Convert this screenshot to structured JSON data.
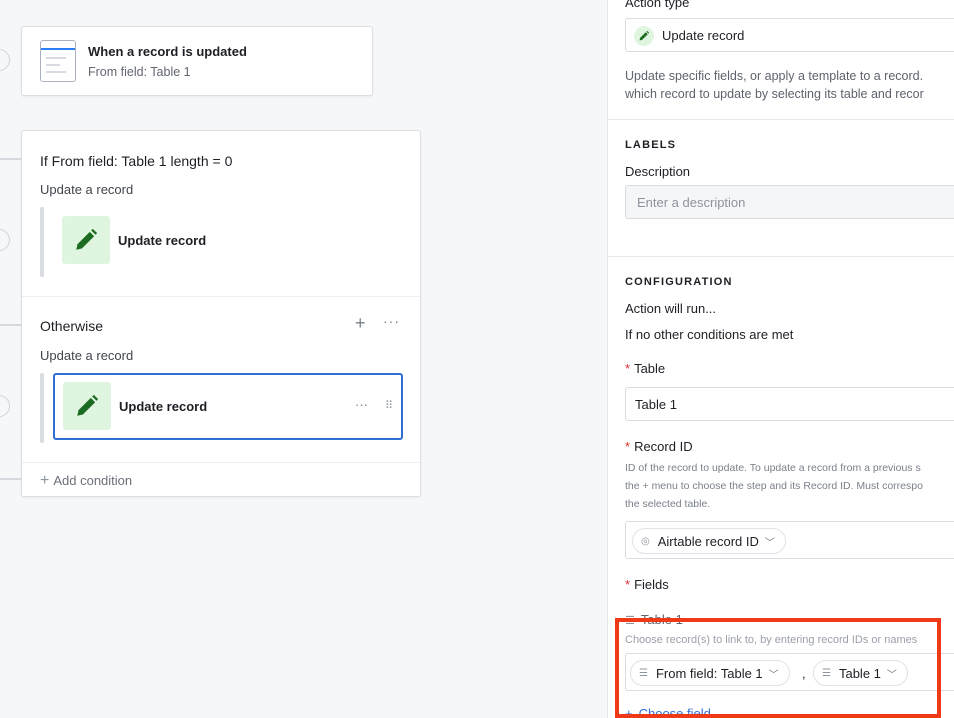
{
  "canvas": {
    "trigger": {
      "title": "When a record is updated",
      "subtitle": "From field: Table 1"
    },
    "condition": {
      "title": "If From field: Table 1 length = 0",
      "subtitle": "Update a record",
      "action_label": "Update record"
    },
    "otherwise": {
      "title": "Otherwise",
      "plus": "+",
      "more": "···",
      "subtitle": "Update a record",
      "action_label": "Update record",
      "action_more": "···",
      "drag": "⠿"
    },
    "add_condition": "Add condition"
  },
  "panel": {
    "action_type_label": "Action type",
    "action_type_value": "Update record",
    "action_type_desc_1": "Update specific fields, or apply a template to a record.",
    "action_type_desc_2": "which record to update by selecting its table and recor",
    "labels_heading": "LABELS",
    "description_label": "Description",
    "description_placeholder": "Enter a description",
    "configuration_heading": "CONFIGURATION",
    "action_will_run": "Action will run...",
    "run_condition": "If no other conditions are met",
    "table_label": "Table",
    "table_value": "Table 1",
    "record_id_label": "Record ID",
    "record_id_desc_1": "ID of the record to update. To update a record from a previous s",
    "record_id_desc_2": "the + menu to choose the step and its Record ID. Must correspo",
    "record_id_desc_3": "the selected table.",
    "record_id_chip": "Airtable record ID",
    "fields_label": "Fields",
    "field_name": "Table 1",
    "field_hint": "Choose record(s) to link to, by entering record IDs or names",
    "field_chip_1": "From field: Table 1",
    "field_separator": ",",
    "field_chip_2": "Table 1",
    "choose_field": "Choose field"
  },
  "colors": {
    "accent": "#2d6fd6",
    "action_icon_bg": "#dff5df",
    "action_icon_fg": "#1b6b22",
    "highlight": "#f03a17"
  }
}
